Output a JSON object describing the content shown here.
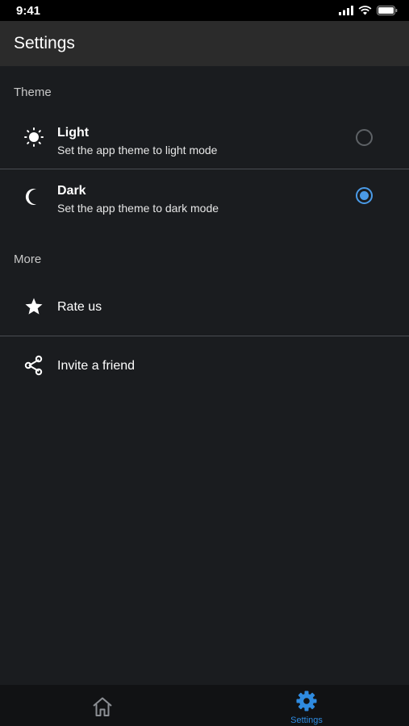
{
  "status_bar": {
    "time": "9:41"
  },
  "header": {
    "title": "Settings"
  },
  "sections": {
    "theme": {
      "label": "Theme",
      "options": [
        {
          "title": "Light",
          "subtitle": "Set the app theme to light mode",
          "selected": false,
          "icon": "sun-icon"
        },
        {
          "title": "Dark",
          "subtitle": "Set the app theme to dark mode",
          "selected": true,
          "icon": "moon-icon"
        }
      ]
    },
    "more": {
      "label": "More",
      "items": [
        {
          "title": "Rate us",
          "icon": "star-icon"
        },
        {
          "title": "Invite a friend",
          "icon": "share-icon"
        }
      ]
    }
  },
  "tab_bar": {
    "tabs": [
      {
        "label": "",
        "icon": "home-icon",
        "active": false
      },
      {
        "label": "Settings",
        "icon": "gear-icon",
        "active": true
      }
    ]
  },
  "colors": {
    "accent": "#4a9be8",
    "background": "#1a1c1f",
    "header": "#2b2b2b"
  }
}
